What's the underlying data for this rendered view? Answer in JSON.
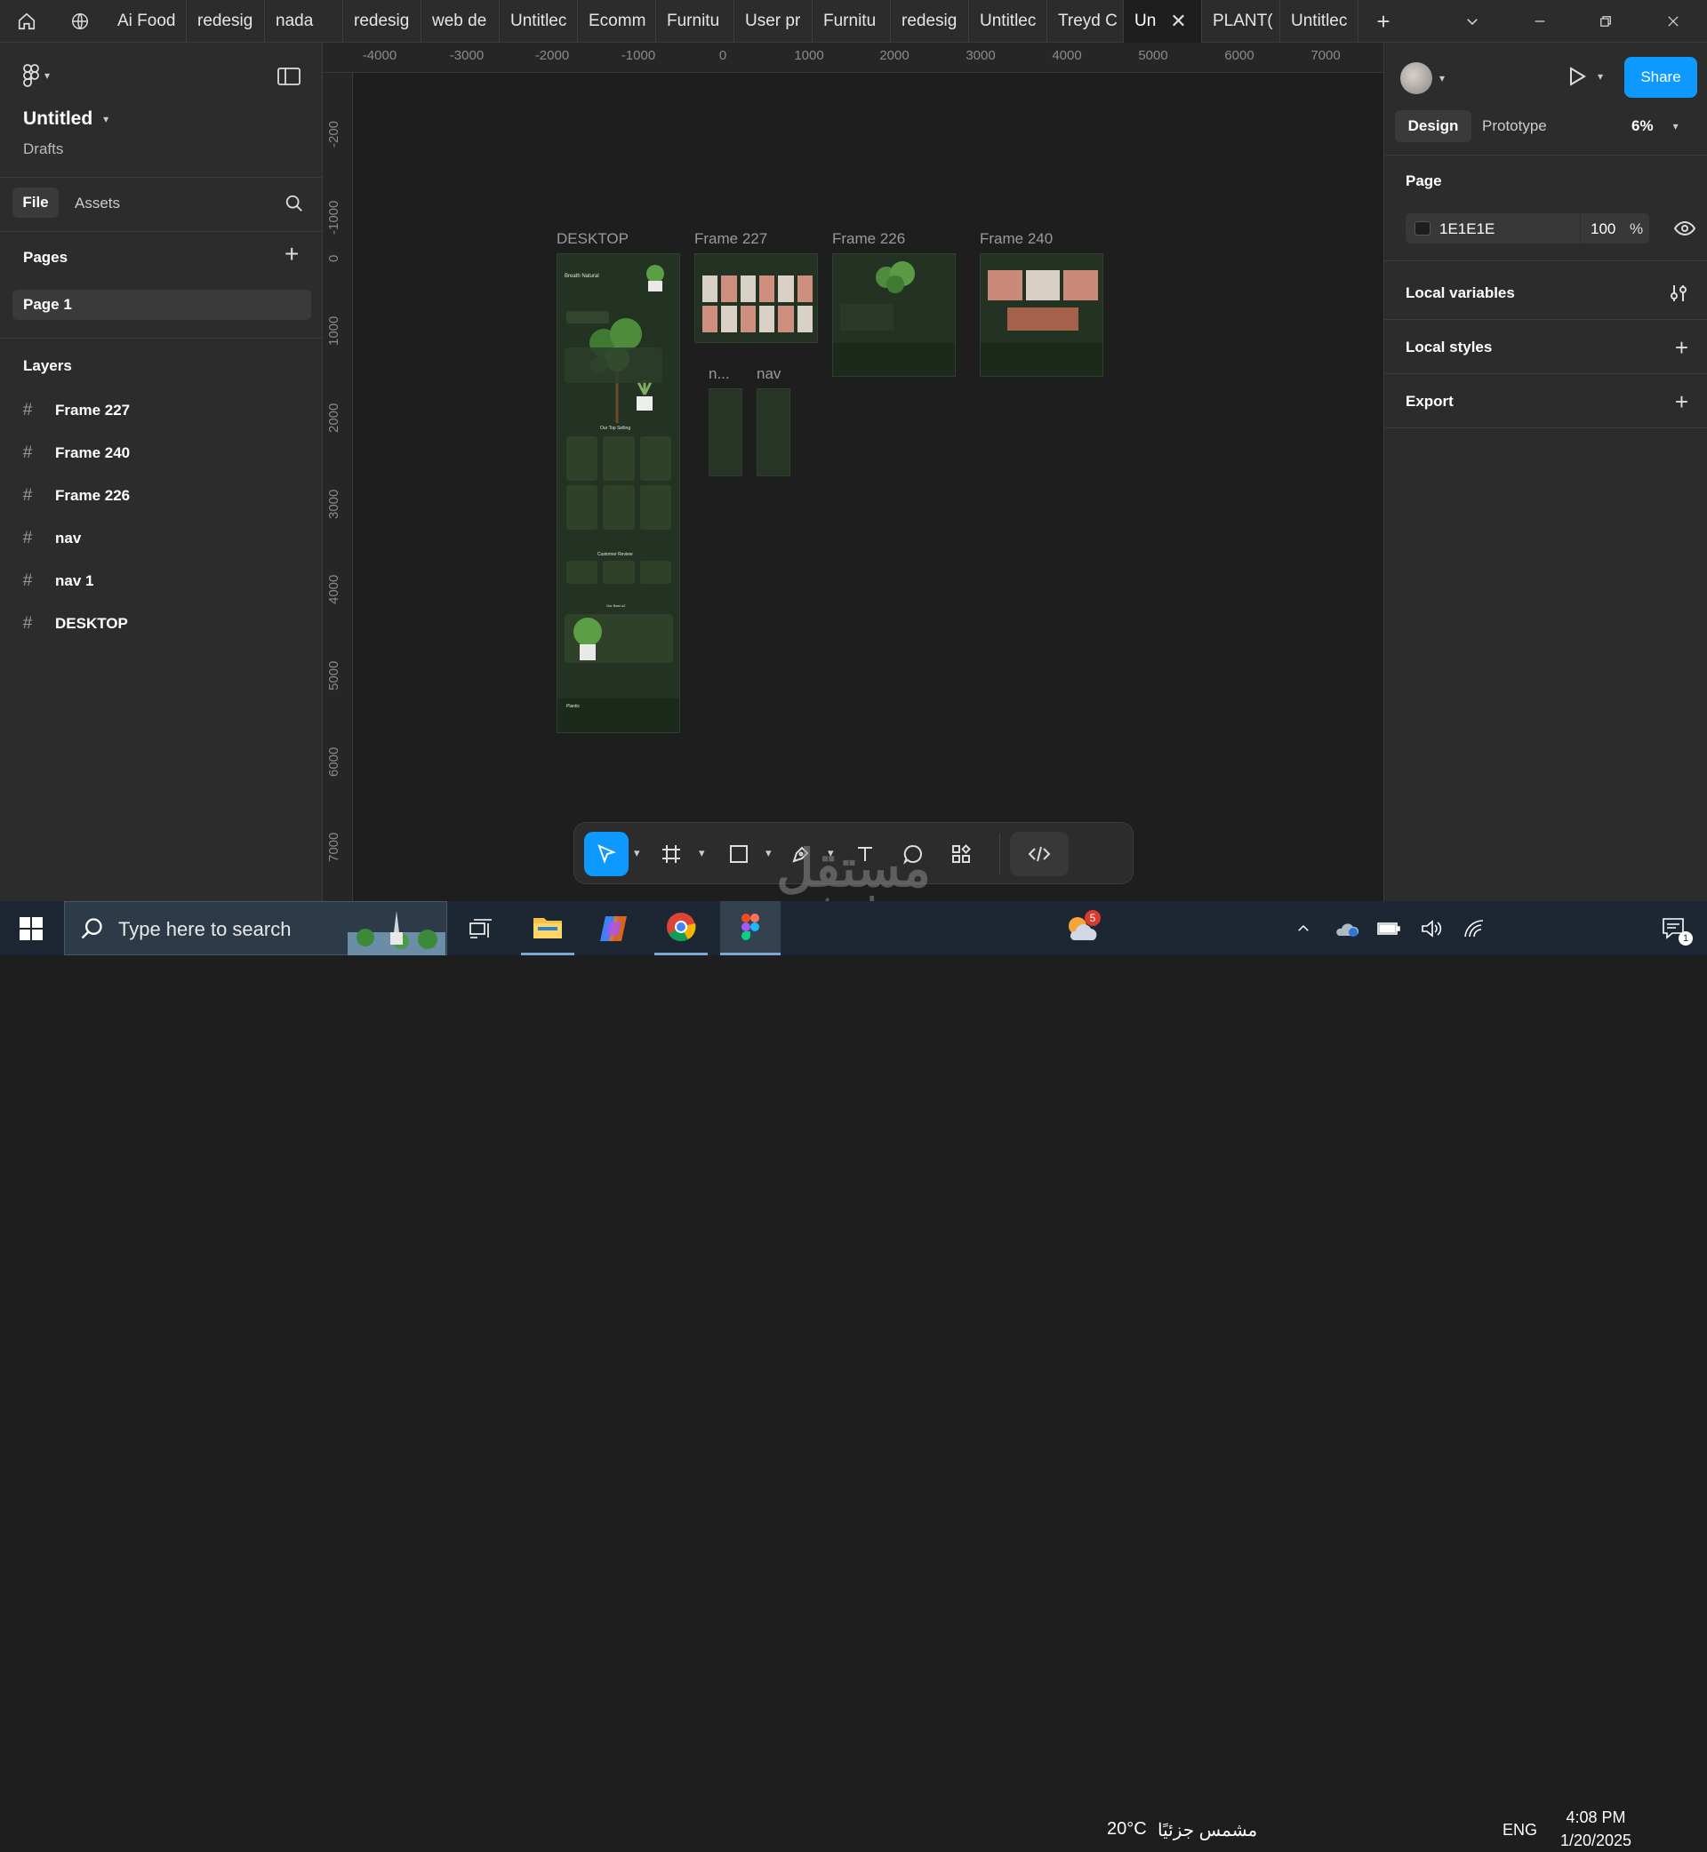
{
  "tabs": [
    {
      "label": "Ai Food"
    },
    {
      "label": "redesig"
    },
    {
      "label": "nada"
    },
    {
      "label": "redesig"
    },
    {
      "label": "web de"
    },
    {
      "label": "Untitlec"
    },
    {
      "label": "Ecomm"
    },
    {
      "label": "Furnitu"
    },
    {
      "label": "User pr"
    },
    {
      "label": "Furnitu"
    },
    {
      "label": "redesig"
    },
    {
      "label": "Untitlec"
    },
    {
      "label": "Treyd C"
    },
    {
      "label": "Un"
    },
    {
      "label": "PLANT("
    },
    {
      "label": "Untitlec"
    }
  ],
  "file": {
    "name": "Untitled",
    "location": "Drafts"
  },
  "left_tabs": {
    "file": "File",
    "assets": "Assets"
  },
  "pages": {
    "heading": "Pages",
    "items": [
      "Page 1"
    ]
  },
  "layers": {
    "heading": "Layers",
    "items": [
      "Frame 227",
      "Frame 240",
      "Frame 226",
      "nav",
      "nav 1",
      "DESKTOP"
    ]
  },
  "right": {
    "share": "Share",
    "tab_design": "Design",
    "tab_prototype": "Prototype",
    "zoom": "6%",
    "page_heading": "Page",
    "page_color": "1E1E1E",
    "page_opacity": "100",
    "percent": "%",
    "local_variables": "Local variables",
    "local_styles": "Local styles",
    "export": "Export"
  },
  "ruler": {
    "h": [
      "-4000",
      "-3000",
      "-2000",
      "-1000",
      "0",
      "1000",
      "2000",
      "3000",
      "4000",
      "5000",
      "6000",
      "7000"
    ],
    "v": [
      "-200",
      "-1000",
      "0",
      "1000",
      "2000",
      "3000",
      "4000",
      "5000",
      "6000",
      "7000"
    ]
  },
  "frames": {
    "desktop": "DESKTOP",
    "f227": "Frame 227",
    "f226": "Frame 226",
    "f240": "Frame 240",
    "nav1": "n...",
    "nav": "nav"
  },
  "desktop_frame_text": {
    "hero": "Breath Natural",
    "top_selling": "Our Top Selling",
    "review": "Customer Review",
    "best": "Our Best o2",
    "brand": "Plantic"
  },
  "help": "?",
  "taskbar": {
    "search_placeholder": "Type here to search",
    "weather_badge": "5",
    "temperature": "20°C",
    "weather_text": "مشمس جزئيًا",
    "language": "ENG",
    "time": "4:08 PM",
    "date": "1/20/2025",
    "notif_count": "1"
  },
  "watermark": {
    "arabic": "مستقل",
    "latin": "mostaql.com"
  },
  "colors": {
    "accent": "#0d99ff",
    "canvas": "#1e1e1e",
    "panel": "#2c2c2c",
    "frame_green": "#233222"
  }
}
